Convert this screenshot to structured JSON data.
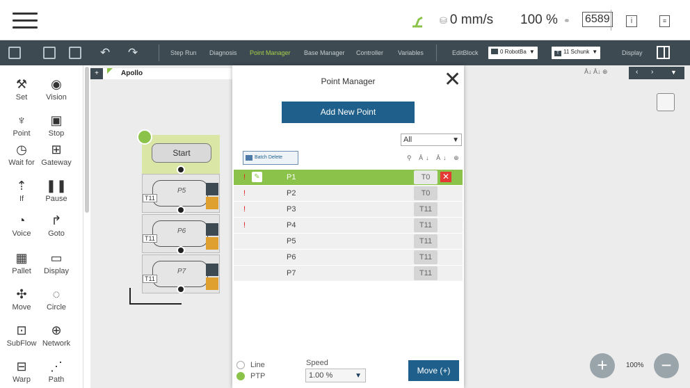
{
  "status": {
    "speed": "0 mm/s",
    "percent": "100 %",
    "counter": "6589"
  },
  "toolbar": {
    "tabs": [
      "Step Run",
      "Diagnosis",
      "Point Manager",
      "Base Manager",
      "Controller",
      "Variables"
    ],
    "active_tab": "Point Manager",
    "edit_block": "EditBlock",
    "base_select": "0 RobotBa",
    "tool_select": "11 Schunk",
    "tool_select_badge": "T",
    "display": "Display"
  },
  "palette": {
    "items": [
      "Set",
      "Vision",
      "Point",
      "Stop",
      "Wait for",
      "Gateway",
      "If",
      "Pause",
      "Voice",
      "Goto",
      "Pallet",
      "Display",
      "Move",
      "Circle",
      "SubFlow",
      "Network",
      "Warp",
      "Path"
    ]
  },
  "flow": {
    "tab_plus": "+",
    "tab_name": "Apollo",
    "start_label": "Start",
    "blocks": [
      {
        "label": "P5",
        "tool": "T11"
      },
      {
        "label": "P6",
        "tool": "T11"
      },
      {
        "label": "P7",
        "tool": "T11"
      }
    ],
    "zoom": "100%"
  },
  "modal": {
    "title": "Point Manager",
    "add_label": "Add New Point",
    "filter_value": "All",
    "batch_delete": "Batch Delete",
    "points": [
      {
        "name": "P1",
        "tool": "T0",
        "warn": "!",
        "selected": true
      },
      {
        "name": "P2",
        "tool": "T0",
        "warn": "!",
        "selected": false
      },
      {
        "name": "P3",
        "tool": "T11",
        "warn": "!",
        "selected": false
      },
      {
        "name": "P4",
        "tool": "T11",
        "warn": "!",
        "selected": false
      },
      {
        "name": "P5",
        "tool": "T11",
        "warn": "",
        "selected": false
      },
      {
        "name": "P6",
        "tool": "T11",
        "warn": "",
        "selected": false
      },
      {
        "name": "P7",
        "tool": "T11",
        "warn": "",
        "selected": false
      }
    ],
    "motion_line": "Line",
    "motion_ptp": "PTP",
    "motion_selected": "PTP",
    "speed_label": "Speed",
    "speed_value": "1.00 %",
    "move_label": "Move (+)"
  }
}
